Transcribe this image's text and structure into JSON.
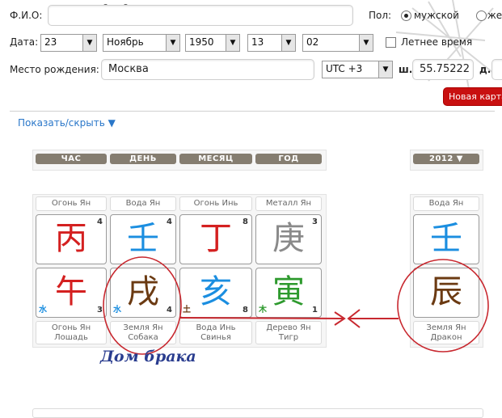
{
  "form": {
    "name_label": "Ф.И.О:",
    "name_value": "",
    "gender_label": "Пол:",
    "gender_male": "мужской",
    "gender_female": "жен",
    "date_label": "Дата:",
    "day": "23",
    "month": "Ноябрь",
    "year": "1950",
    "hour": "13",
    "minute": "02",
    "dst_label": "Летнее время",
    "place_label": "Место рождения:",
    "place_value": "Москва",
    "utc": "UTC +3",
    "lat_label": "ш.",
    "lat_value": "55.75222",
    "lon_label": "д.",
    "new_chart_button": "Новая карта"
  },
  "toggle_label": "Показать/скрыть ▼",
  "columns": [
    {
      "header": "ЧАС",
      "stem_element": "Огонь Ян",
      "stem": "丙",
      "stem_color": "#d42020",
      "stem_num": "4",
      "branch": "午",
      "branch_color": "#d42020",
      "hidden": "水",
      "hidden_color": "#1b8ee0",
      "branch_num": "3",
      "desc1": "Огонь Ян",
      "desc2": "Лошадь"
    },
    {
      "header": "ДЕНЬ",
      "stem_element": "Вода Ян",
      "stem": "壬",
      "stem_color": "#1b8ee0",
      "stem_num": "4",
      "branch": "戌",
      "branch_color": "#6b3a12",
      "hidden": "水",
      "hidden_color": "#1b8ee0",
      "branch_num": "4",
      "desc1": "Земля Ян",
      "desc2": "Собака"
    },
    {
      "header": "МЕСЯЦ",
      "stem_element": "Огонь Инь",
      "stem": "丁",
      "stem_color": "#d42020",
      "stem_num": "8",
      "branch": "亥",
      "branch_color": "#1b8ee0",
      "hidden": "土",
      "hidden_color": "#6b3a12",
      "branch_num": "8",
      "desc1": "Вода Инь",
      "desc2": "Свинья"
    },
    {
      "header": "ГОД",
      "stem_element": "Металл Ян",
      "stem": "庚",
      "stem_color": "#8a8a8a",
      "stem_num": "3",
      "branch": "寅",
      "branch_color": "#2e9a2e",
      "hidden": "木",
      "hidden_color": "#2e9a2e",
      "branch_num": "1",
      "desc1": "Дерево Ян",
      "desc2": "Тигр"
    }
  ],
  "luck": {
    "header": "2012 ▼",
    "stem_element": "Вода Ян",
    "stem": "壬",
    "stem_color": "#1b8ee0",
    "branch": "辰",
    "branch_color": "#6b3a12",
    "desc1": "Земля Ян",
    "desc2": "Дракон"
  },
  "annotation": "Дом брака",
  "annotation_color": "#c8282f"
}
